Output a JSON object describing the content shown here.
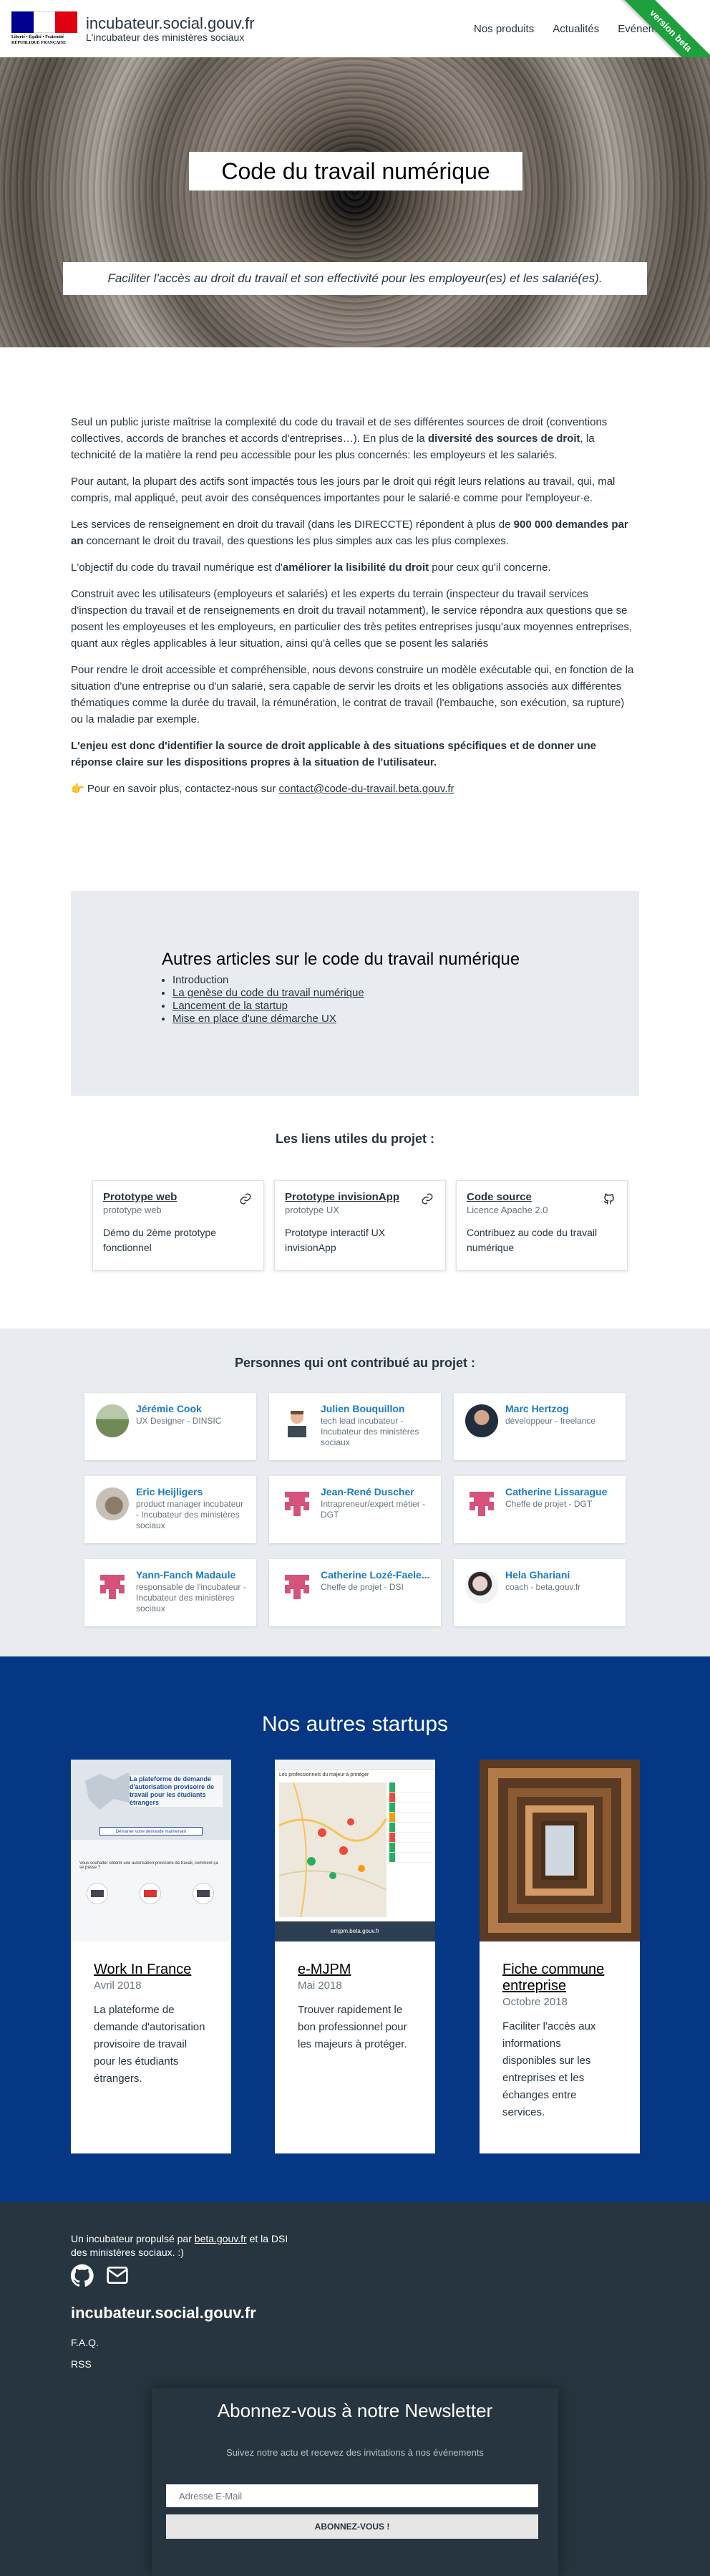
{
  "header": {
    "logo_text": "Liberté • Égalité • Fraternité RÉPUBLIQUE FRANÇAISE",
    "site_title": "incubateur.social.gouv.fr",
    "site_subtitle": "L'incubateur des ministères sociaux",
    "nav": [
      "Nos produits",
      "Actualités",
      "Evénements"
    ],
    "ribbon": "version beta"
  },
  "hero": {
    "title": "Code du travail numérique",
    "subtitle": "Faciliter l'accès au droit du travail et son effectivité pour les employeur(es) et les salarié(es)."
  },
  "article": {
    "p1_a": "Seul un public juriste maîtrise la complexité du code du travail et de ses différentes sources de droit (conventions collectives, accords de branches et accords d'entreprises…). En plus de la ",
    "p1_b": "diversité des sources de droit",
    "p1_c": ", la technicité de la matière la rend peu accessible pour les plus concernés: les employeurs et les salariés.",
    "p2": "Pour autant, la plupart des actifs sont impactés tous les jours par le droit qui régit leurs relations au travail, qui, mal compris, mal appliqué, peut avoir des conséquences importantes pour le salarié·e comme pour l'employeur·e.",
    "p3_a": "Les services de renseignement en droit du travail (dans les DIRECCTE) répondent à plus de ",
    "p3_b": "900 000 demandes par an",
    "p3_c": " concernant le droit du travail, des questions les plus simples aux cas les plus complexes.",
    "p4_a": "L'objectif du code du travail numérique est d'",
    "p4_b": "améliorer la lisibilité du droit",
    "p4_c": " pour ceux qu'il concerne.",
    "p5": "Construit avec les utilisateurs (employeurs et salariés) et les experts du terrain (inspecteur du travail services d'inspection du travail et de renseignements en droit du travail notamment), le service répondra aux questions que se posent les employeuses et les employeurs, en particulier des très petites entreprises jusqu'aux moyennes entreprises, quant aux règles applicables à leur situation, ainsi qu'à celles que se posent les salariés",
    "p6": "Pour rendre le droit accessible et compréhensible, nous devons construire un modèle exécutable qui, en fonction de la situation d'une entreprise ou d'un salarié, sera capable de servir les droits et les obligations associés aux différentes thématiques comme la durée du travail, la rémunération, le contrat de travail (l'embauche, son exécution, sa rupture) ou la maladie par exemple.",
    "p7": "L'enjeu est donc d'identifier la source de droit applicable à des situations spécifiques et de donner une réponse claire sur les dispositions propres à la situation de l'utilisateur.",
    "contact_prefix": "👉 Pour en savoir plus, contactez-nous sur ",
    "contact_email": "contact@code-du-travail.beta.gouv.fr"
  },
  "other_articles": {
    "title": "Autres articles sur le code du travail numérique",
    "items": [
      "Introduction",
      "La genèse du code du travail numérique",
      "Lancement de la startup",
      "Mise en place d'une démarche UX"
    ]
  },
  "useful_links": {
    "title": "Les liens utiles du projet :",
    "cards": [
      {
        "title": "Prototype web",
        "subtitle": "prototype web",
        "desc": "Démo du 2ème prototype fonctionnel",
        "icon": "link-icon"
      },
      {
        "title": "Prototype invisionApp",
        "subtitle": "prototype UX",
        "desc": "Prototype interactif UX invisionApp",
        "icon": "link-icon"
      },
      {
        "title": "Code source",
        "subtitle": "Licence Apache 2.0",
        "desc": "Contribuez au code du travail numérique",
        "icon": "github-icon"
      }
    ]
  },
  "people": {
    "title": "Personnes qui ont contribué au projet :",
    "list": [
      {
        "name": "Jérémie Cook",
        "role": "UX Designer - DINSIC"
      },
      {
        "name": "Julien Bouquillon",
        "role": "tech lead incubateur - Incubateur des ministères sociaux"
      },
      {
        "name": "Marc Hertzog",
        "role": "développeur - freelance"
      },
      {
        "name": "Eric Heijligers",
        "role": "product manager incubateur - Incubateur des ministères sociaux"
      },
      {
        "name": "Jean-René Duscher",
        "role": "Intrapreneur/expert métier - DGT"
      },
      {
        "name": "Catherine Lissarague",
        "role": "Cheffe de projet - DGT"
      },
      {
        "name": "Yann-Fanch Madaule",
        "role": "responsable de l'incubateur - Incubateur des ministères sociaux"
      },
      {
        "name": "Catherine Lozé-Faele...",
        "role": "Cheffe de projet - DSI"
      },
      {
        "name": "Hela Ghariani",
        "role": "coach - beta.gouv.fr"
      }
    ]
  },
  "startups": {
    "title": "Nos autres startups",
    "list": [
      {
        "title": "Work In France",
        "date": "Avril 2018",
        "desc": "La plateforme de demande d'autorisation provisoire de travail pour les étudiants étrangers.",
        "shot_caption": "La plateforme de demande d'autorisation provisoire de travail pour les étudiants étrangers",
        "shot_button": "Démarrer votre demande maintenant",
        "shot_question": "Vous souhaiter obtenir une autorisation provisoire de travail, comment ça se passe ?"
      },
      {
        "title": "e-MJPM",
        "date": "Mai 2018",
        "desc": "Trouver rapidement le bon professionnel pour les majeurs à protéger.",
        "shot_caption": "Les professionnels du majeur à protéger",
        "shot_footer": "emjpm.beta.gouv.fr"
      },
      {
        "title": "Fiche commune entreprise",
        "date": "Octobre 2018",
        "desc": "Faciliter l'accès aux informations disponibles sur les entreprises et les échanges entre services."
      }
    ]
  },
  "footer": {
    "made_by_prefix": "Un incubateur propulsé par ",
    "made_by_link": "beta.gouv.fr",
    "made_by_suffix": " et la DSI des ministères sociaux. :)",
    "brand": "incubateur.social.gouv.fr",
    "links": [
      "F.A.Q.",
      "RSS"
    ],
    "newsletter_title": "Abonnez-vous à notre Newsletter",
    "newsletter_sub": "Suivez notre actu et recevez des invitations à nos événements",
    "newsletter_placeholder": "Adresse E-Mail",
    "newsletter_button": "ABONNEZ-VOUS !"
  }
}
